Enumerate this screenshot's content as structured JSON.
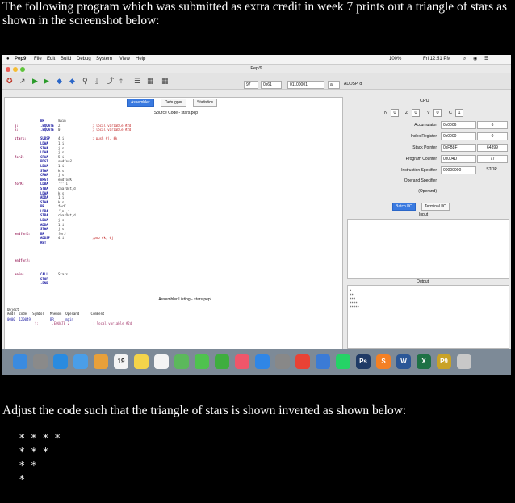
{
  "question": {
    "intro": "The following program which was submitted as extra credit in week 7 prints out a triangle of stars as shown in the screenshot below:",
    "instruction": "Adjust the code such that the triangle of stars is shown inverted as shown below:",
    "inverted_stars": [
      "* * * *",
      "* * *",
      "* *",
      "*"
    ]
  },
  "menubar": {
    "app": "Pep9",
    "items": [
      "File",
      "Edit",
      "Build",
      "Debug",
      "System",
      "View",
      "Help"
    ],
    "status_right": "100%",
    "clock": "Fri 12:51 PM"
  },
  "window": {
    "title": "Pep/9",
    "toolbar_fields": [
      "97",
      "0x61",
      "01100001",
      "a"
    ],
    "instruction": "ADDSP, d"
  },
  "tabs": {
    "items": [
      "Assembler",
      "Debugger",
      "Statistics"
    ],
    "active": 0
  },
  "source": {
    "title": "Source Code - stars.pep",
    "labels": [
      "",
      "j:",
      "k:",
      "",
      "stars:",
      "",
      "",
      "",
      "forJ:",
      "",
      "",
      "",
      "",
      "",
      "forK:",
      "",
      "",
      "",
      "",
      "",
      "",
      "",
      "",
      "",
      "",
      "endforK:",
      "",
      "",
      "",
      "",
      "",
      "endforJ:",
      "",
      "",
      "main:",
      "",
      ""
    ],
    "mnemonics": [
      "BR",
      ".EQUATE",
      ".EQUATE",
      "",
      "SUBSP",
      "LDWA",
      "STWA",
      "LDWA",
      "CPWA",
      "BRGT",
      "LDWA",
      "STWA",
      "CPWA",
      "BRGT",
      "LDBA",
      "STBA",
      "LDWA",
      "ADDA",
      "STWA",
      "BR",
      "LDBA",
      "STBA",
      "LDWA",
      "ADDA",
      "STWA",
      "BR",
      "ADDSP",
      "RET",
      "",
      "",
      "",
      "",
      "",
      "",
      "CALL",
      "STOP",
      ".END"
    ],
    "operands": [
      "main",
      "2",
      "0",
      "",
      "4,i",
      "1,i",
      "j,s",
      "j,s",
      "5,i",
      "endforJ",
      "1,i",
      "k,s",
      "j,s",
      "endforK",
      "'*',i",
      "charOut,d",
      "k,s",
      "1,i",
      "k,s",
      "forK",
      "'\\n',i",
      "charOut,d",
      "j,s",
      "1,i",
      "j,s",
      "forJ",
      "4,i",
      "",
      "",
      "",
      "",
      "",
      "",
      "",
      "Stars",
      "",
      ""
    ],
    "comments": [
      "",
      "; local variable #2d",
      "; local variable #2d",
      "",
      "; push #j, #k",
      "",
      "",
      "",
      "",
      "",
      "",
      "",
      "",
      "",
      "",
      "",
      "",
      "",
      "",
      "",
      "",
      "",
      "",
      "",
      "",
      "",
      ";pop #k, #j",
      "",
      "",
      "",
      "",
      "",
      "",
      "",
      "",
      "",
      ""
    ]
  },
  "listing": {
    "title": "Assembler Listing - stars.pepl",
    "header": [
      "Object",
      "Addr  code   Symbol   Mnemon  Operand      Comment"
    ],
    "rows": [
      "0000  120049          BR      main",
      "              j:       .EQUATE 2            ; local variable #2d"
    ]
  },
  "cpu": {
    "title": "CPU",
    "flags": [
      [
        "N",
        "0"
      ],
      [
        "Z",
        "0"
      ],
      [
        "V",
        "0"
      ],
      [
        "C",
        "1"
      ]
    ],
    "registers": [
      {
        "label": "Accumulator",
        "hex": "0x0006",
        "dec": "6"
      },
      {
        "label": "Index Register",
        "hex": "0x0000",
        "dec": "0"
      },
      {
        "label": "Stack Pointer",
        "hex": "0xFB8F",
        "dec": "64399"
      },
      {
        "label": "Program Counter",
        "hex": "0x004D",
        "dec": "77"
      },
      {
        "label": "Instruction Specifier",
        "hex": "00000000",
        "dec": "STOP"
      },
      {
        "label": "Operand Specifier",
        "hex": "",
        "dec": ""
      },
      {
        "label": "(Operand)",
        "hex": "",
        "dec": ""
      }
    ]
  },
  "io": {
    "tabs": [
      "Batch I/O",
      "Terminal I/O"
    ],
    "input_label": "Input",
    "output_label": "Output",
    "output_lines": [
      "*",
      "**",
      "***",
      "****",
      "*****"
    ]
  },
  "colors": {
    "accent": "#3a7ae0",
    "dock": "#7d8a97"
  },
  "dock": {
    "icons": [
      "finder-icon",
      "launchpad-icon",
      "safari-icon",
      "mail-icon",
      "photos-icon",
      "calendar-icon",
      "notes-icon",
      "reminders-icon",
      "maps-icon",
      "messages-icon",
      "facetime-icon",
      "music-icon",
      "appstore-icon",
      "settings-icon",
      "chrome-icon",
      "pepper-icon",
      "whatsapp-icon",
      "photoshop-icon",
      "sublime-icon",
      "word-icon",
      "excel-icon",
      "pep9-icon",
      "trash-icon"
    ]
  }
}
